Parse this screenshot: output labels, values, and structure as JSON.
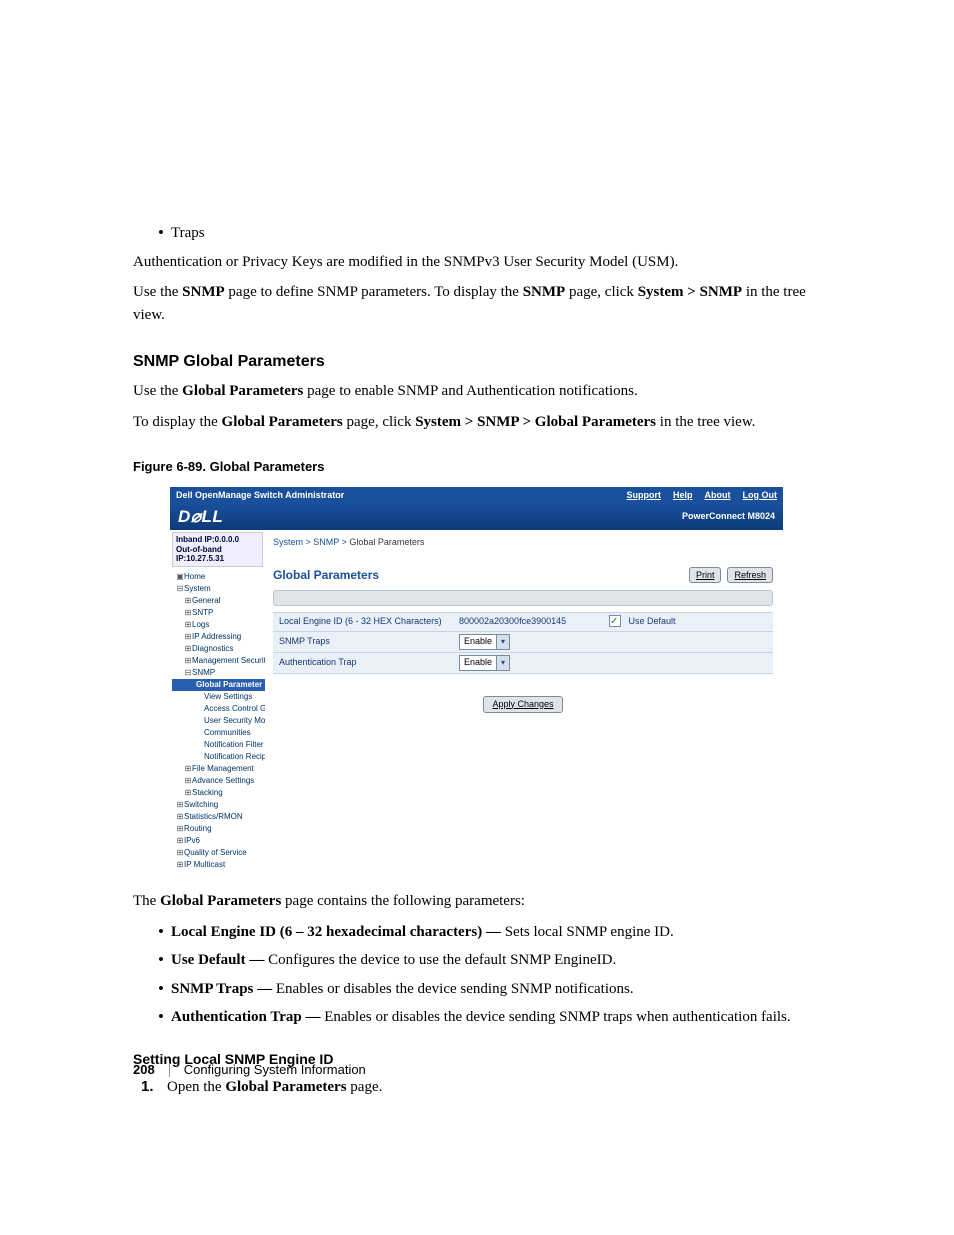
{
  "bullets_intro": [
    "Traps"
  ],
  "paras_intro": [
    "Authentication or Privacy Keys are modified in the SNMPv3 User Security Model (USM).",
    [
      "Use the ",
      "SNMP",
      " page to define SNMP parameters. To display the ",
      "SNMP",
      " page, click ",
      "System > SNMP",
      " in the tree view."
    ]
  ],
  "section_heading": "SNMP Global Parameters",
  "section_paras": [
    [
      "Use the ",
      "Global Parameters",
      " page to enable SNMP and Authentication notifications."
    ],
    [
      "To display the ",
      "Global Parameters",
      " page, click ",
      "System > SNMP > Global Parameters",
      " in the tree view."
    ]
  ],
  "figure_caption": "Figure 6-89.    Global Parameters",
  "screenshot": {
    "titlebar_left": "Dell OpenManage Switch Administrator",
    "titlebar_links": [
      "Support",
      "Help",
      "About",
      "Log Out"
    ],
    "band_right": "PowerConnect M8024",
    "ip1": "Inband IP:0.0.0.0",
    "ip2": "Out-of-band IP:10.27.5.31",
    "tree": [
      {
        "lvl": 1,
        "glyph": "▣",
        "label": "Home"
      },
      {
        "lvl": 1,
        "glyph": "⊟",
        "label": "System"
      },
      {
        "lvl": 2,
        "glyph": "⊞",
        "label": "General"
      },
      {
        "lvl": 2,
        "glyph": "⊞",
        "label": "SNTP"
      },
      {
        "lvl": 2,
        "glyph": "⊞",
        "label": "Logs"
      },
      {
        "lvl": 2,
        "glyph": "⊞",
        "label": "IP Addressing"
      },
      {
        "lvl": 2,
        "glyph": "⊞",
        "label": "Diagnostics"
      },
      {
        "lvl": 2,
        "glyph": "⊞",
        "label": "Management Security"
      },
      {
        "lvl": 2,
        "glyph": "⊟",
        "label": "SNMP"
      },
      {
        "lvl": 3,
        "selected": true,
        "label": "Global Parameter"
      },
      {
        "lvl": 3,
        "label": "View Settings"
      },
      {
        "lvl": 3,
        "label": "Access Control Gro"
      },
      {
        "lvl": 3,
        "label": "User Security Mode"
      },
      {
        "lvl": 3,
        "label": "Communities"
      },
      {
        "lvl": 3,
        "label": "Notification Filter"
      },
      {
        "lvl": 3,
        "label": "Notification Recipien"
      },
      {
        "lvl": 2,
        "glyph": "⊞",
        "label": "File Management"
      },
      {
        "lvl": 2,
        "glyph": "⊞",
        "label": "Advance Settings"
      },
      {
        "lvl": 2,
        "glyph": "⊞",
        "label": "Stacking"
      },
      {
        "lvl": 1,
        "glyph": "⊞",
        "label": "Switching"
      },
      {
        "lvl": 1,
        "glyph": "⊞",
        "label": "Statistics/RMON"
      },
      {
        "lvl": 1,
        "glyph": "⊞",
        "label": "Routing"
      },
      {
        "lvl": 1,
        "glyph": "⊞",
        "label": "IPv6"
      },
      {
        "lvl": 1,
        "glyph": "⊞",
        "label": "Quality of Service"
      },
      {
        "lvl": 1,
        "glyph": "⊞",
        "label": "IP Multicast"
      }
    ],
    "breadcrumb": [
      "System",
      "SNMP",
      "Global Parameters"
    ],
    "panel_title": "Global Parameters",
    "print_label": "Print",
    "refresh_label": "Refresh",
    "rows": {
      "engine_label": "Local Engine ID (6 - 32 HEX Characters)",
      "engine_value": "800002a20300fce3900145",
      "use_default_label": "Use Default",
      "use_default_checked": true,
      "traps_label": "SNMP Traps",
      "traps_value": "Enable",
      "auth_label": "Authentication Trap",
      "auth_value": "Enable"
    },
    "apply_label": "Apply Changes"
  },
  "after_fig_para": [
    "The ",
    "Global Parameters",
    " page contains the following parameters:"
  ],
  "param_bullets": [
    [
      "Local Engine ID (6 – 32 hexadecimal characters) — ",
      "Sets local SNMP engine ID."
    ],
    [
      "Use Default — ",
      "Configures the device to use the default SNMP EngineID."
    ],
    [
      "SNMP Traps — ",
      "Enables or disables the device sending SNMP notifications."
    ],
    [
      "Authentication Trap — ",
      "Enables or disables the device sending SNMP traps when authentication fails."
    ]
  ],
  "setting_heading": "Setting Local SNMP Engine ID",
  "ol_1": [
    "Open the ",
    "Global Parameters",
    " page."
  ],
  "footer": {
    "page_number": "208",
    "chapter": "Configuring System Information"
  }
}
